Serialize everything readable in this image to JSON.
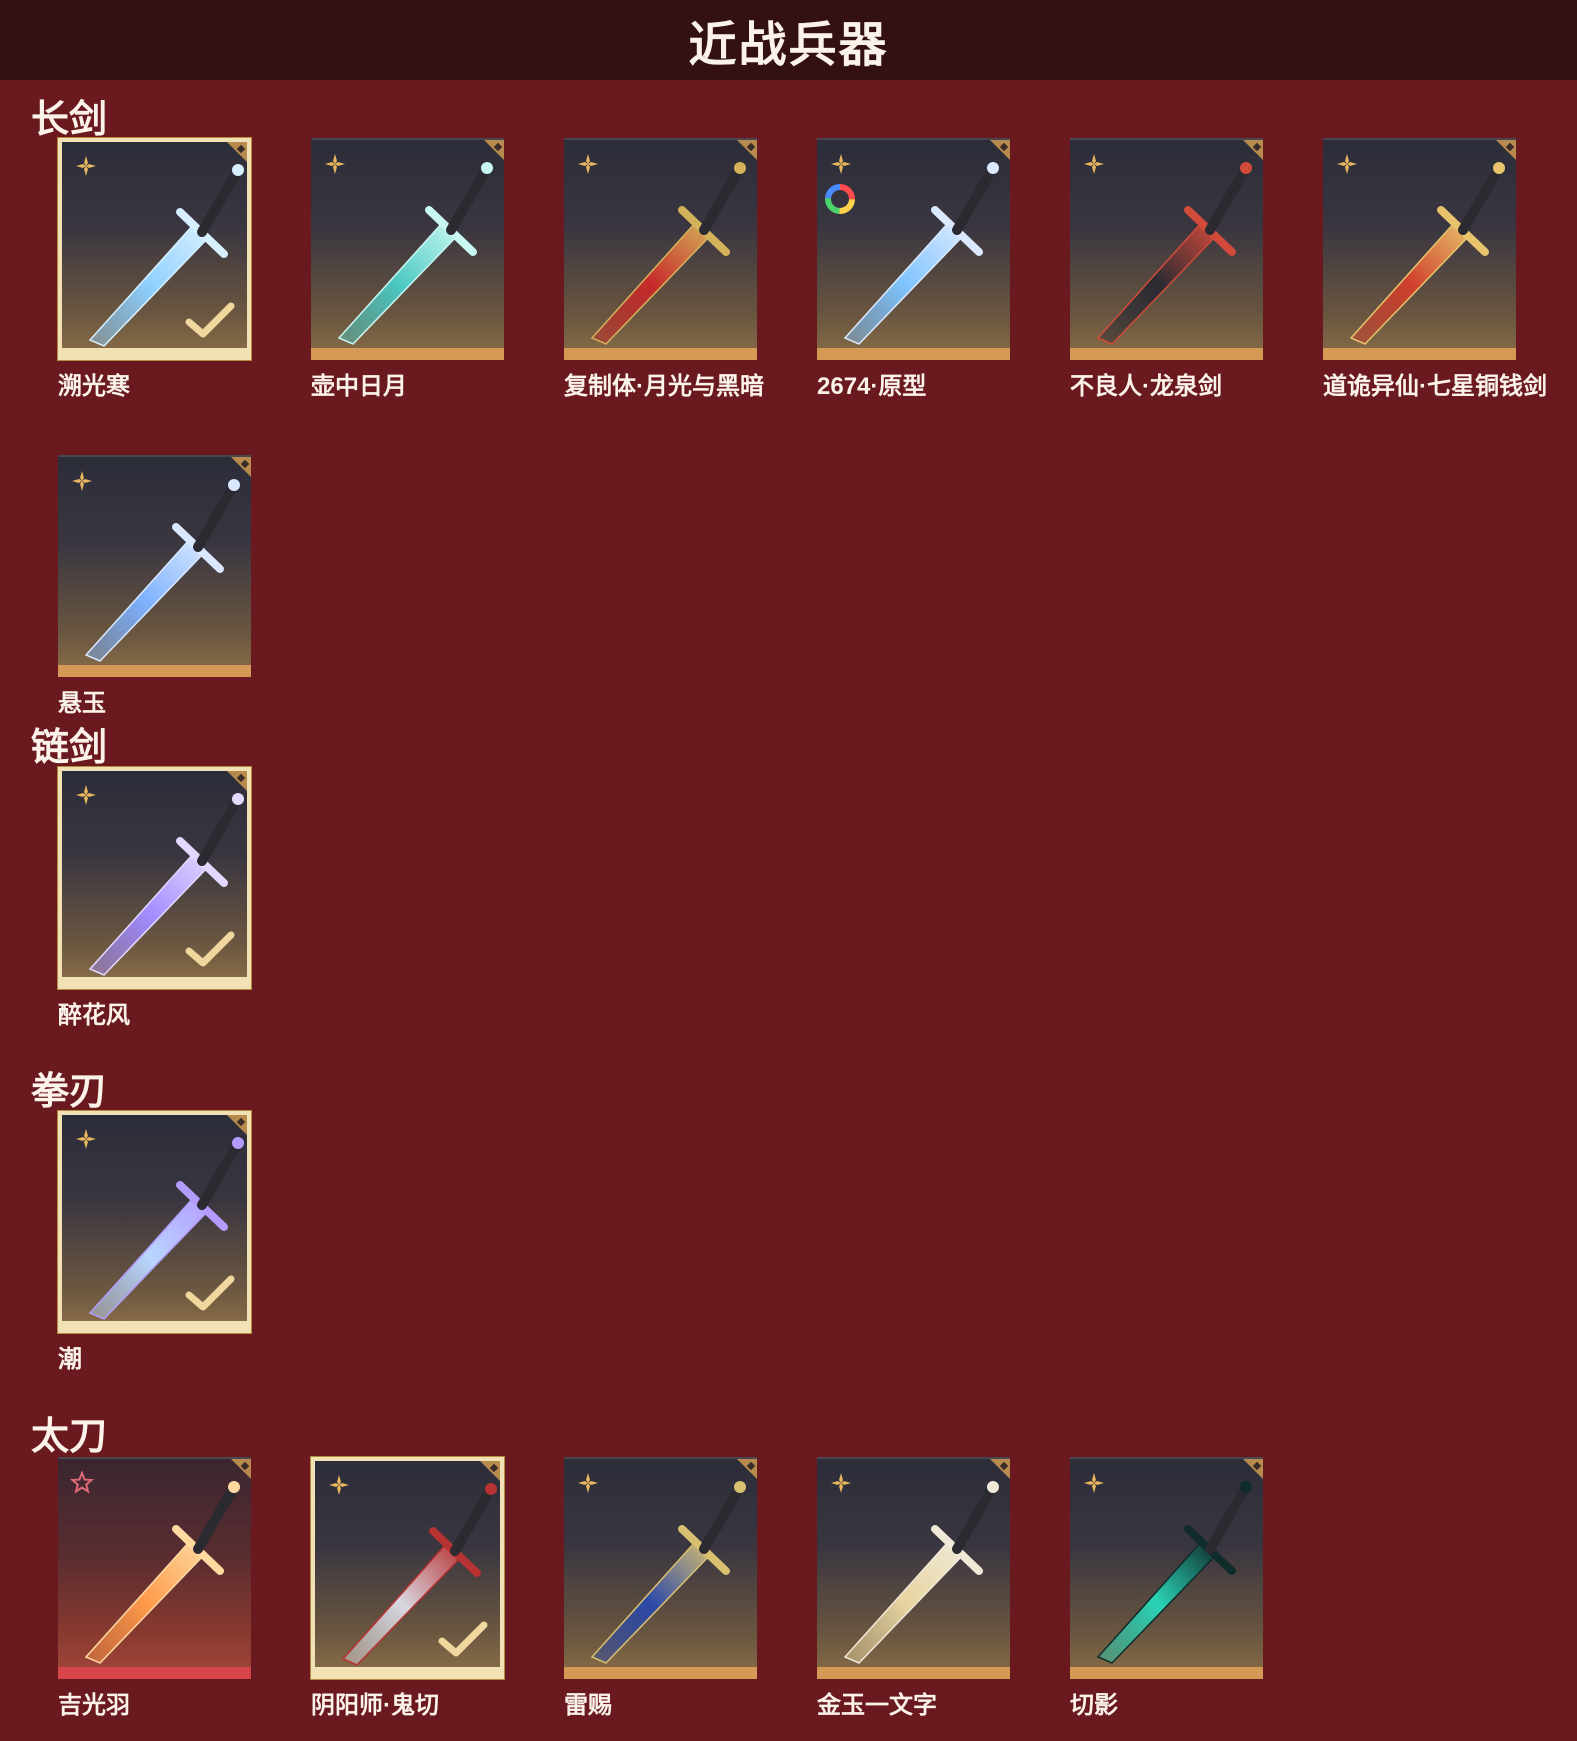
{
  "header": {
    "title": "近战兵器"
  },
  "sections": [
    {
      "title": "长剑",
      "items": [
        {
          "name": "溯光寒",
          "selected": true,
          "badge": "flower-icon",
          "blade": "#8fd0ff",
          "accent": "#d7f0ff"
        },
        {
          "name": "壶中日月",
          "selected": false,
          "badge": "flower-icon",
          "blade": "#4cc9c2",
          "accent": "#c9f7f2"
        },
        {
          "name": "复制体·月光与黑暗",
          "selected": false,
          "badge": "flower-icon",
          "blade": "#c72a2a",
          "accent": "#d4b25a"
        },
        {
          "name": "2674·原型",
          "selected": false,
          "badge": "flower-icon",
          "color_ring": true,
          "blade": "#7fc4ff",
          "accent": "#dbe9ff"
        },
        {
          "name": "不良人·龙泉剑",
          "selected": false,
          "badge": "flower-icon",
          "blade": "#2b2b33",
          "accent": "#d24a3a"
        },
        {
          "name": "道诡异仙·七星铜钱剑",
          "selected": false,
          "badge": "flower-icon",
          "blade": "#d0402c",
          "accent": "#e7c36b"
        },
        {
          "name": "悬玉",
          "selected": false,
          "badge": "flower-icon",
          "blade": "#7fb2ff",
          "accent": "#d9e8ff"
        }
      ]
    },
    {
      "title": "链剑",
      "items": [
        {
          "name": "醉花风",
          "selected": true,
          "badge": "flower-icon",
          "blade": "#a38cff",
          "accent": "#e3d8ff"
        }
      ]
    },
    {
      "title": "拳刃",
      "items": [
        {
          "name": "潮",
          "selected": true,
          "badge": "flower-icon",
          "blade": "#b9d6ff",
          "accent": "#b49cff"
        }
      ]
    },
    {
      "title": "太刀",
      "items": [
        {
          "name": "吉光羽",
          "selected": false,
          "rare": true,
          "badge": "star-icon",
          "blade": "#ff9a4a",
          "accent": "#ffd9a0"
        },
        {
          "name": "阴阳师·鬼切",
          "selected": true,
          "badge": "flower-icon",
          "blade": "#d8d8e0",
          "accent": "#b73232"
        },
        {
          "name": "雷赐",
          "selected": false,
          "badge": "flower-icon",
          "blade": "#2d4aa8",
          "accent": "#d8c070"
        },
        {
          "name": "金玉一文字",
          "selected": false,
          "badge": "flower-icon",
          "blade": "#e7d4a0",
          "accent": "#f0e9d8"
        },
        {
          "name": "切影",
          "selected": false,
          "badge": "flower-icon",
          "blade": "#2bd3b6",
          "accent": "#0f2b2a"
        }
      ]
    }
  ]
}
